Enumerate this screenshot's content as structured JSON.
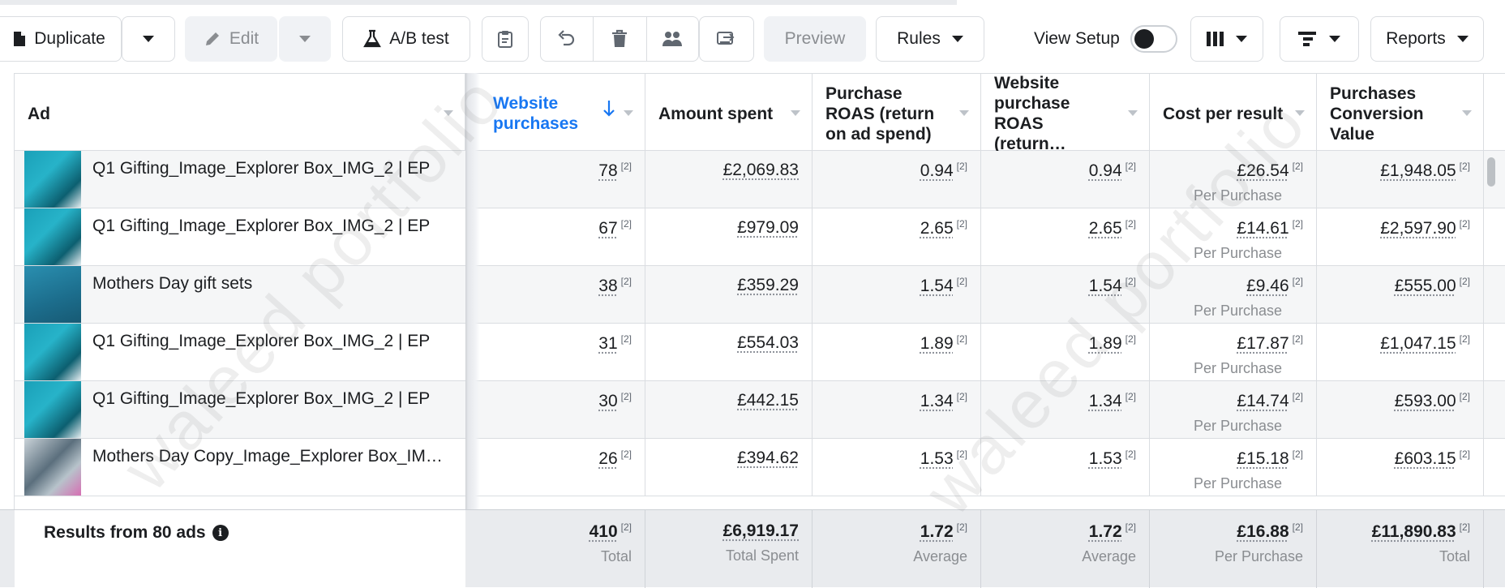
{
  "toolbar": {
    "duplicate": "Duplicate",
    "edit": "Edit",
    "ab_test": "A/B test",
    "preview": "Preview",
    "rules": "Rules",
    "view_setup": "View Setup",
    "reports": "Reports"
  },
  "columns": {
    "ad": "Ad",
    "website_purchases": "Website purchases",
    "amount_spent": "Amount spent",
    "purchase_roas": "Purchase ROAS (return on ad spend)",
    "website_purchase_roas": "Website purchase ROAS (return…",
    "cost_per_result": "Cost per result",
    "purchases_conversion_value": "Purchases Conversion Value"
  },
  "footnote": "[2]",
  "rows": [
    {
      "ad": "Q1 Gifting_Image_Explorer Box_IMG_2 | EP",
      "purchases": "78",
      "spent": "£2,069.83",
      "roas": "0.94",
      "web_roas": "0.94",
      "cpr": "£26.54",
      "cpr_sub": "Per Purchase",
      "value": "£1,948.05"
    },
    {
      "ad": "Q1 Gifting_Image_Explorer Box_IMG_2 | EP",
      "purchases": "67",
      "spent": "£979.09",
      "roas": "2.65",
      "web_roas": "2.65",
      "cpr": "£14.61",
      "cpr_sub": "Per Purchase",
      "value": "£2,597.90"
    },
    {
      "ad": "Mothers Day gift sets",
      "purchases": "38",
      "spent": "£359.29",
      "roas": "1.54",
      "web_roas": "1.54",
      "cpr": "£9.46",
      "cpr_sub": "Per Purchase",
      "value": "£555.00"
    },
    {
      "ad": "Q1 Gifting_Image_Explorer Box_IMG_2 | EP",
      "purchases": "31",
      "spent": "£554.03",
      "roas": "1.89",
      "web_roas": "1.89",
      "cpr": "£17.87",
      "cpr_sub": "Per Purchase",
      "value": "£1,047.15"
    },
    {
      "ad": "Q1 Gifting_Image_Explorer Box_IMG_2 | EP",
      "purchases": "30",
      "spent": "£442.15",
      "roas": "1.34",
      "web_roas": "1.34",
      "cpr": "£14.74",
      "cpr_sub": "Per Purchase",
      "value": "£593.00"
    },
    {
      "ad": "Mothers Day Copy_Image_Explorer Box_IM…",
      "purchases": "26",
      "spent": "£394.62",
      "roas": "1.53",
      "web_roas": "1.53",
      "cpr": "£15.18",
      "cpr_sub": "Per Purchase",
      "value": "£603.15"
    }
  ],
  "footer": {
    "results": "Results from 80 ads",
    "purchases": "410",
    "purchases_sub": "Total",
    "spent": "£6,919.17",
    "spent_sub": "Total Spent",
    "roas": "1.72",
    "roas_sub": "Average",
    "web_roas": "1.72",
    "web_roas_sub": "Average",
    "cpr": "£16.88",
    "cpr_sub": "Per Purchase",
    "value": "£11,890.83",
    "value_sub": "Total"
  },
  "watermark": "waleed portfolio",
  "colors": {
    "accent": "#1877f2",
    "thumb_teal": "#1aa0b8",
    "thumb_dark": "#0c5f70"
  }
}
